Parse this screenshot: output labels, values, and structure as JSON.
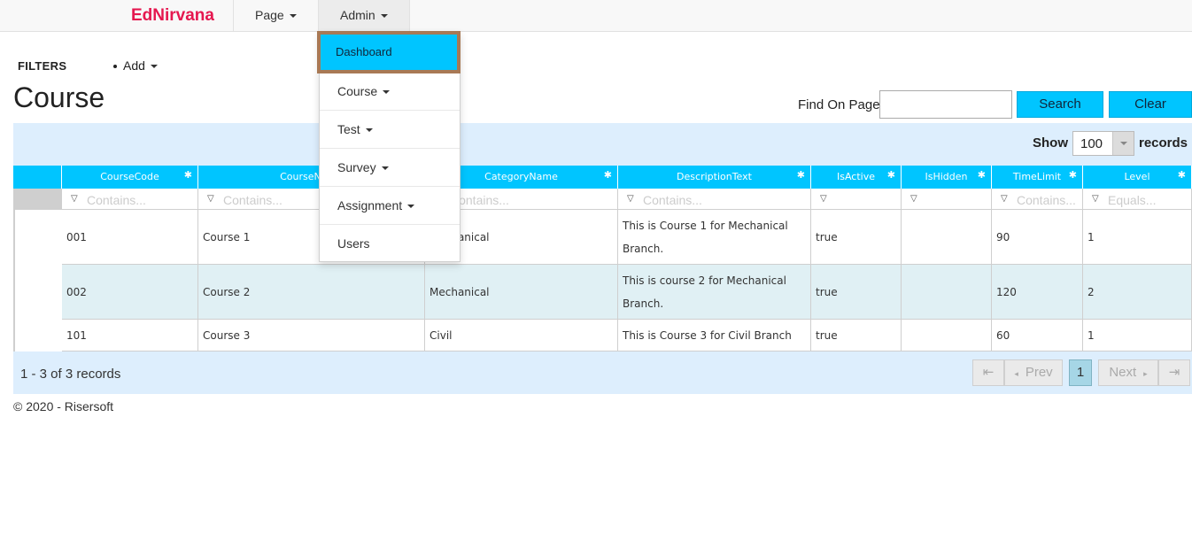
{
  "navbar": {
    "brand": "EdNirvana",
    "menu_page": "Page",
    "menu_admin": "Admin"
  },
  "dropdown": {
    "items": [
      "Dashboard",
      "Course",
      "Test",
      "Survey",
      "Assignment",
      "Users"
    ],
    "active": "Dashboard"
  },
  "toolbar": {
    "filters_label": "FILTERS",
    "add_label": "Add",
    "title": "Course",
    "find_label": "Find On Page",
    "find_value": "",
    "search_label": "Search",
    "clear_label": "Clear"
  },
  "grid": {
    "show_label": "Show",
    "page_size": "100",
    "records_label": "records",
    "columns": [
      "CourseCode",
      "CourseName",
      "CategoryName",
      "DescriptionText",
      "IsActive",
      "IsHidden",
      "TimeLimit",
      "Level"
    ],
    "filter_placeholders": [
      "Contains...",
      "Contains...",
      "Contains...",
      "Contains...",
      "",
      "",
      "Contains...",
      "Equals..."
    ],
    "rows": [
      {
        "code": "001",
        "name": "Course 1",
        "category": "Mechanical",
        "description": "This is Course 1 for Mechanical Branch.",
        "active": "true",
        "hidden": "",
        "time": "90",
        "level": "1"
      },
      {
        "code": "002",
        "name": "Course 2",
        "category": "Mechanical",
        "description": "This is course 2 for Mechanical Branch.",
        "active": "true",
        "hidden": "",
        "time": "120",
        "level": "2"
      },
      {
        "code": "101",
        "name": "Course 3",
        "category": "Civil",
        "description": "This is Course 3 for Civil Branch",
        "active": "true",
        "hidden": "",
        "time": "60",
        "level": "1"
      }
    ],
    "record_count": "1 - 3 of 3 records",
    "pager": {
      "first": "⇤",
      "prev": "Prev",
      "current_page": "1",
      "next": "Next",
      "last": "⇥"
    }
  },
  "footer": {
    "copyright": "© 2020 - Risersoft"
  },
  "colors": {
    "accent": "#00c5ff",
    "brand": "#e5174f",
    "highlight_border": "#a87955",
    "toolbar_bg": "#ddeefd"
  }
}
